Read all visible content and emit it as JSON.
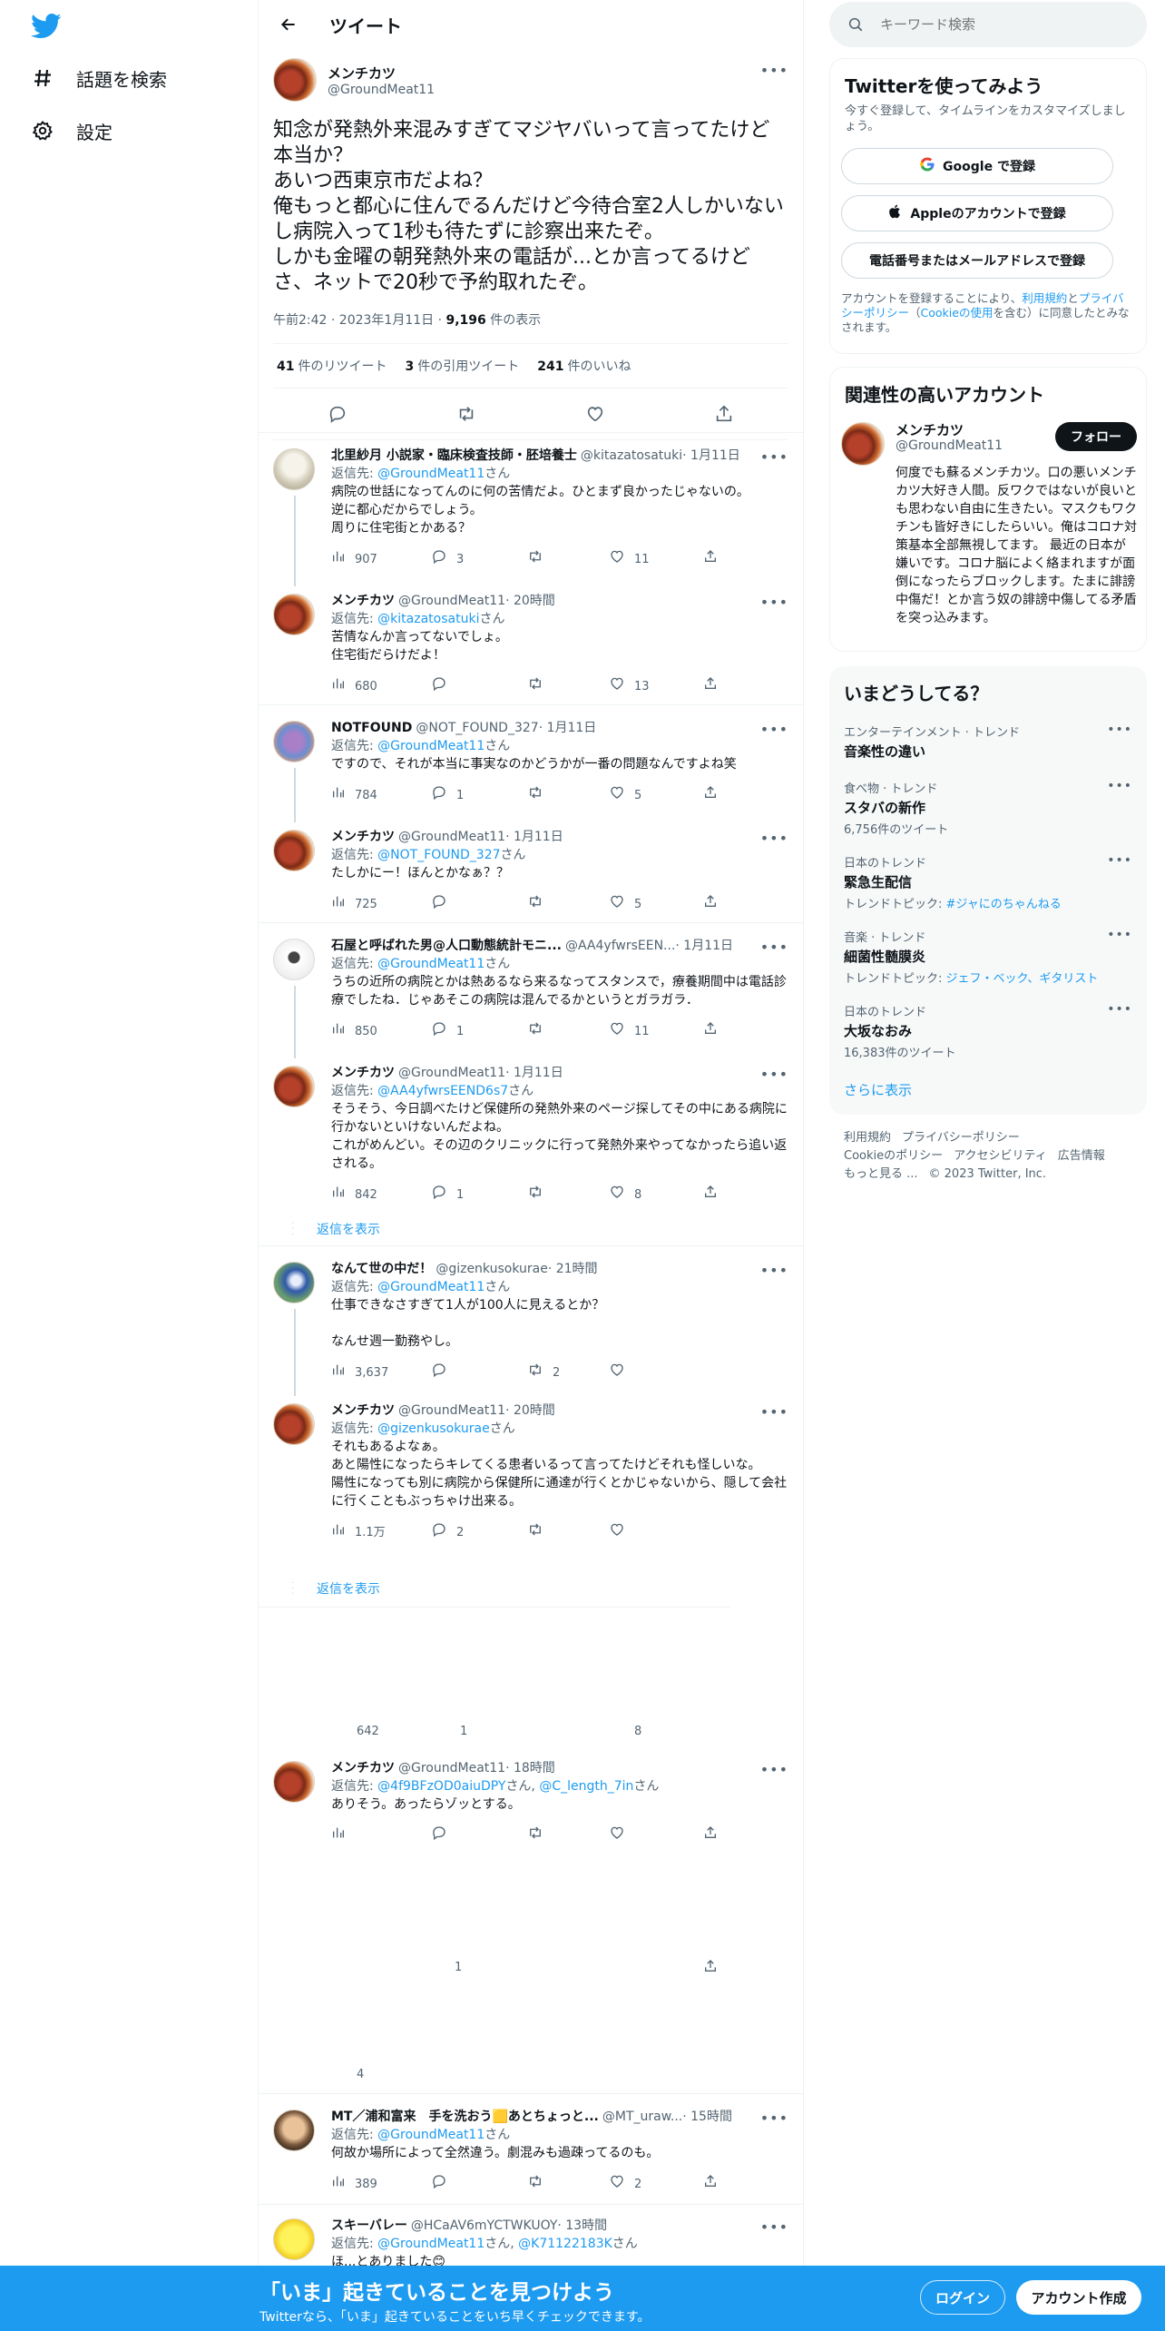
{
  "nav": {
    "logo_icon": "twitter-bird-icon",
    "items": [
      {
        "label": "話題を検索",
        "icon": "hashtag-icon"
      },
      {
        "label": "設定",
        "icon": "gear-icon"
      }
    ]
  },
  "header": {
    "title": "ツイート",
    "back_icon": "arrow-left-icon"
  },
  "focal": {
    "display_name": "メンチカツ",
    "handle": "@GroundMeat11",
    "text": "知念が発熱外来混みすぎてマジヤバいって言ってたけど本当か？\nあいつ西東京市だよね？\n俺もっと都心に住んでるんだけど今待合室2人しかいないし病院入って1秒も待たずに診察出来たぞ。\nしかも金曜の朝発熱外来の電話が...とか言ってるけどさ、ネットで20秒で予約取れたぞ。",
    "time": "午前2:42 · 2023年1月11日 · ",
    "views": "9,196",
    "views_label": " 件の表示",
    "retweets": "41",
    "retweets_label": "件のリツイート",
    "quotes": "3",
    "quotes_label": "件の引用ツイート",
    "likes": "241",
    "likes_label": "件のいいね"
  },
  "replies": [
    {
      "name": "北里紗月 小説家・臨床検査技師・胚培養士",
      "handle": "@kitazatosatuki",
      "time": " · 1月11日",
      "replyto_prefix": "返信先: ",
      "replyto": "@GroundMeat11",
      "replyto_suffix": "さん",
      "text": "病院の世話になってんのに何の苦情だよ。ひとまず良かったじゃないの。\n逆に都心だからでしょう。\n周りに住宅街とかある？",
      "views": "907",
      "replies": "3",
      "retweets": "",
      "likes": "11"
    },
    {
      "name": "メンチカツ",
      "handle": "@GroundMeat11",
      "time": " · 20時間",
      "replyto_prefix": "返信先: ",
      "replyto": "@kitazatosatuki",
      "replyto_suffix": "さん",
      "text": "苦情なんか言ってないでしょ。\n住宅街だらけだよ！",
      "views": "680",
      "replies": "",
      "retweets": "",
      "likes": "13"
    },
    {
      "name": "NOTFOUND",
      "handle": "@NOT_FOUND_327",
      "time": " · 1月11日",
      "replyto_prefix": "返信先: ",
      "replyto": "@GroundMeat11",
      "replyto_suffix": "さん",
      "text": "ですので、それが本当に事実なのかどうかが一番の問題なんですよね笑",
      "views": "784",
      "replies": "1",
      "retweets": "",
      "likes": "5"
    },
    {
      "name": "メンチカツ",
      "handle": "@GroundMeat11",
      "time": " · 1月11日",
      "replyto_prefix": "返信先: ",
      "replyto": "@NOT_FOUND_327",
      "replyto_suffix": "さん",
      "text": "たしかにー！ほんとかなぁ？？",
      "views": "725",
      "replies": "",
      "retweets": "",
      "likes": "5"
    },
    {
      "name": "石屋と呼ばれた男@人口動態統計モニ...",
      "handle": "@AA4yfwrsEEN...",
      "time": " · 1月11日",
      "replyto_prefix": "返信先: ",
      "replyto": "@GroundMeat11",
      "replyto_suffix": "さん",
      "text": "うちの近所の病院とかは熱あるなら来るなってスタンスで，療養期間中は電話診療でしたね．じゃあそこの病院は混んでるかというとガラガラ．",
      "views": "850",
      "replies": "1",
      "retweets": "",
      "likes": "11"
    },
    {
      "name": "メンチカツ",
      "handle": "@GroundMeat11",
      "time": " · 1月11日",
      "replyto_prefix": "返信先: ",
      "replyto": "@AA4yfwrsEEND6s7",
      "replyto_suffix": "さん",
      "text": "そうそう、今日調べたけど保健所の発熱外来のページ探してその中にある病院に行かないといけないんだよね。\nこれがめんどい。その辺のクリニックに行って発熱外来やってなかったら追い返される。",
      "views": "842",
      "replies": "1",
      "retweets": "",
      "likes": "8"
    },
    {
      "name": "なんて世の中だ！",
      "handle": "@gizenkusokurae",
      "time": " · 21時間",
      "replyto_prefix": "返信先: ",
      "replyto": "@GroundMeat11",
      "replyto_suffix": "さん",
      "text": "仕事できなさすぎて1人が100人に見えるとか？\n\nなんせ週一勤務やし。",
      "views": "3,637",
      "replies": "",
      "retweets": "2",
      "likes": ""
    },
    {
      "name": "メンチカツ",
      "handle": "@GroundMeat11",
      "time": " · 20時間",
      "replyto_prefix": "返信先: ",
      "replyto": "@gizenkusokurae",
      "replyto_suffix": "さん",
      "text": "それもあるよなぁ。\nあと陽性になったらキレてくる患者いるって言ってたけどそれも怪しいな。\n陽性になっても別に病院から保健所に通達が行くとかじゃないから、隠して会社に行くこともぶっちゃけ出来る。",
      "views": "1.1万",
      "replies": "2",
      "retweets": "",
      "likes": ""
    },
    {
      "name": "メンチカツ",
      "handle": "@GroundMeat11",
      "time": " · 18時間",
      "replyto_prefix": "返信先: ",
      "replyto": "@4f9BFzOD0aiuDPY",
      "replyto_mid": "さん, ",
      "replyto2": "@C_length_7in",
      "replyto_suffix": "さん",
      "text": "ありそう。あったらゾッとする。",
      "views": "",
      "replies": "",
      "retweets": "",
      "likes": ""
    },
    {
      "name": "MT／浦和富来　手を洗おう🟨あとちょっと...",
      "handle": "@MT_uraw...",
      "time": " · 15時間",
      "replyto_prefix": "返信先: ",
      "replyto": "@GroundMeat11",
      "replyto_suffix": "さん",
      "text": "何故か場所によって全然違う。劇混みも過疎ってるのも。",
      "views": "389",
      "replies": "",
      "retweets": "",
      "likes": "2"
    },
    {
      "name": "スキーバレー",
      "handle": "@HCaAV6mYCTWKUOY",
      "time": " · 13時間",
      "replyto_prefix": "返信先: ",
      "replyto": "@GroundMeat11",
      "replyto_mid": "さん, ",
      "replyto2": "@K71122183K",
      "replyto_suffix": "さん",
      "text": "ほ...とありました😊"
    }
  ],
  "show_replies_label": "返信を表示",
  "ghost_counts": {
    "a": "642",
    "b": "1",
    "c": "8",
    "d": "1",
    "e": "4"
  },
  "search": {
    "placeholder": "キーワード検索"
  },
  "signup": {
    "title": "Twitterを使ってみよう",
    "subtitle": "今すぐ登録して、タイムラインをカスタマイズしましょう。",
    "google": "Google で登録",
    "apple": "Appleのアカウントで登録",
    "phone": "電話番号またはメールアドレスで登録",
    "legal_prefix": "アカウントを登録することにより、",
    "legal_terms": "利用規約",
    "legal_and": "と",
    "legal_privacy": "プライバシーポリシー",
    "legal_cookie_open": "（",
    "legal_cookie": "Cookieの使用",
    "legal_suffix": "を含む）に同意したとみなされます。"
  },
  "related": {
    "title": "関連性の高いアカウント",
    "name": "メンチカツ",
    "handle": "@GroundMeat11",
    "follow": "フォロー",
    "bio": "何度でも蘇るメンチカツ。口の悪いメンチカツ大好き人間。反ワクではないが良いとも思わない自由に生きたい。マスクもワクチンも皆好きにしたらいい。俺はコロナ対策基本全部無視してます。 最近の日本が嫌いです。コロナ脳によく絡まれますが面倒になったらブロックします。たまに誹謗中傷だ！とか言う奴の誹謗中傷してる矛盾を突っ込みます。"
  },
  "trends": {
    "title": "いまどうしてる？",
    "items": [
      {
        "category": "エンターテインメント · トレンド",
        "name": "音楽性の違い",
        "sub": ""
      },
      {
        "category": "食べ物 · トレンド",
        "name": "スタバの新作",
        "sub": "6,756件のツイート"
      },
      {
        "category": "日本のトレンド",
        "name": "緊急生配信",
        "sub": "トレンドトピック: ",
        "sub_link": "#ジャにのちゃんねる"
      },
      {
        "category": "音楽 · トレンド",
        "name": "細菌性髄膜炎",
        "sub": "トレンドトピック: ",
        "sub_link": "ジェフ・ベック、ギタリスト"
      },
      {
        "category": "日本のトレンド",
        "name": "大坂なおみ",
        "sub": "16,383件のツイート"
      }
    ],
    "show_more": "さらに表示"
  },
  "footer": {
    "links": [
      "利用規約",
      "プライバシーポリシー",
      "Cookieのポリシー",
      "アクセシビリティ",
      "広告情報",
      "もっと見る ...",
      "© 2023 Twitter, Inc."
    ]
  },
  "bottombar": {
    "title": "「いま」起きていることを見つけよう",
    "subtitle": "Twitterなら、「いま」起きていることをいち早くチェックできます。",
    "login": "ログイン",
    "signup": "アカウント作成"
  },
  "colors": {
    "accent": "#1d9bf0",
    "text": "#0f1419",
    "muted": "#536471",
    "border": "#eff3f4"
  }
}
